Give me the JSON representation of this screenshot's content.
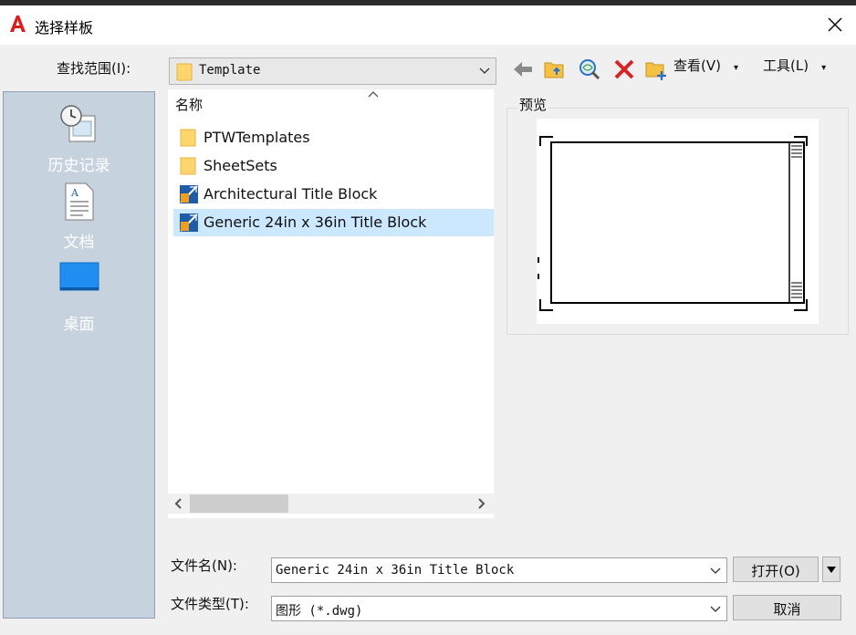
{
  "window": {
    "title": "选择样板"
  },
  "lookin": {
    "label": "查找范围(I):",
    "value": "Template"
  },
  "toolbar": {
    "views_label": "查看(V)",
    "tools_label": "工具(L)"
  },
  "places": [
    {
      "label": "历史记录",
      "icon": "history-icon"
    },
    {
      "label": "文档",
      "icon": "document-icon"
    },
    {
      "label": "桌面",
      "icon": "desktop-icon"
    }
  ],
  "filelist": {
    "column_header": "名称",
    "items": [
      {
        "name": "PTWTemplates",
        "type": "folder"
      },
      {
        "name": "SheetSets",
        "type": "folder"
      },
      {
        "name": "Architectural Title Block",
        "type": "template"
      },
      {
        "name": "Generic 24in x 36in Title Block",
        "type": "template",
        "selected": true
      }
    ]
  },
  "preview": {
    "label": "预览"
  },
  "filename": {
    "label": "文件名(N):",
    "value": "Generic 24in x 36in Title Block"
  },
  "filetype": {
    "label": "文件类型(T):",
    "value": "图形 (*.dwg)"
  },
  "buttons": {
    "open": "打开(O)",
    "cancel": "取消"
  },
  "colors": {
    "selection": "#cce8ff",
    "places_bg": "#c6d2de",
    "app_red": "#d81e1e"
  }
}
